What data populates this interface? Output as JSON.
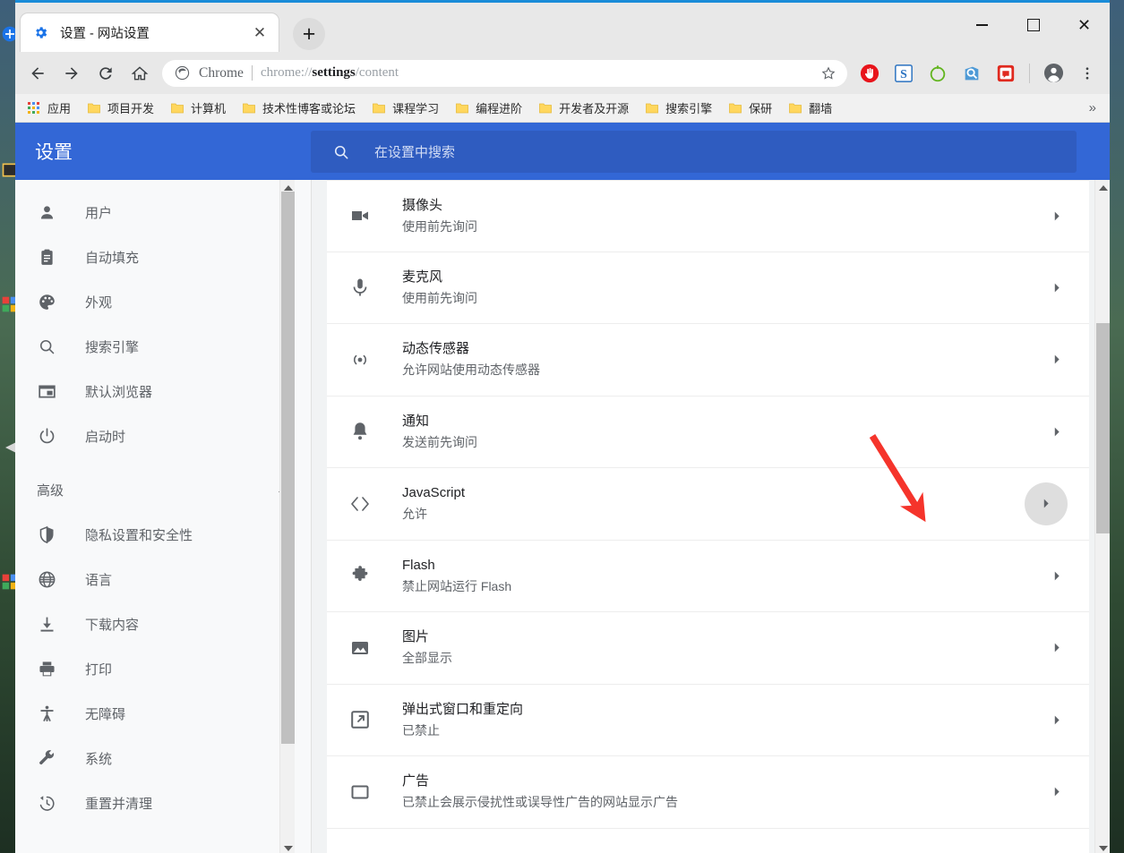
{
  "window": {
    "controls": {
      "minimize": "—",
      "maximize": "□",
      "close": "✕"
    }
  },
  "tabs": [
    {
      "title": "设置 - 网站设置",
      "favicon": "settings-gear-icon",
      "close_label": "✕"
    }
  ],
  "newtab_label": "+",
  "toolbar": {
    "back_label": "←",
    "forward_label": "→",
    "reload_label": "⟳",
    "home_label": "⌂",
    "omnibox": {
      "brand": "Chrome",
      "separator": "|",
      "url_prefix": "chrome://",
      "url_bold": "settings",
      "url_suffix": "/content",
      "full_url": "chrome://settings/content"
    },
    "star_label": "☆",
    "extensions": [
      {
        "name": "adblock-extension-icon",
        "color": "#e8141b"
      },
      {
        "name": "sogou-extension-icon",
        "color": "#2a72c0"
      },
      {
        "name": "green-circle-extension-icon",
        "color": "#63b520"
      },
      {
        "name": "search-magnifier-extension-icon",
        "color": "#3b7dbd"
      },
      {
        "name": "red-square-extension-icon",
        "color": "#e02a1f"
      }
    ],
    "profile_label": "●",
    "menu_label": "⋮"
  },
  "bookmarks": {
    "apps_label": "应用",
    "items": [
      "项目开发",
      "计算机",
      "技术性博客或论坛",
      "课程学习",
      "编程进阶",
      "开发者及开源",
      "搜索引擎",
      "保研",
      "翻墙"
    ],
    "overflow_label": "»"
  },
  "settings": {
    "header": {
      "title": "设置",
      "search_placeholder": "在设置中搜索",
      "accent_color": "#3367d6",
      "search_bg": "#2f5cc0"
    },
    "sidebar": {
      "items": [
        {
          "label": "用户",
          "icon": "person-icon"
        },
        {
          "label": "自动填充",
          "icon": "clipboard-icon"
        },
        {
          "label": "外观",
          "icon": "palette-icon"
        },
        {
          "label": "搜索引擎",
          "icon": "search-icon"
        },
        {
          "label": "默认浏览器",
          "icon": "browser-window-icon"
        },
        {
          "label": "启动时",
          "icon": "power-icon"
        }
      ],
      "section": {
        "label": "高级",
        "icon": "chevron-up-icon",
        "expanded": true
      },
      "advanced_items": [
        {
          "label": "隐私设置和安全性",
          "icon": "shield-icon"
        },
        {
          "label": "语言",
          "icon": "globe-icon"
        },
        {
          "label": "下载内容",
          "icon": "download-icon"
        },
        {
          "label": "打印",
          "icon": "printer-icon"
        },
        {
          "label": "无障碍",
          "icon": "accessibility-icon"
        },
        {
          "label": "系统",
          "icon": "wrench-icon"
        },
        {
          "label": "重置并清理",
          "icon": "history-restore-icon"
        }
      ]
    },
    "content_rows": [
      {
        "title": "摄像头",
        "sub": "使用前先询问",
        "icon": "camera-icon",
        "hovered": false
      },
      {
        "title": "麦克风",
        "sub": "使用前先询问",
        "icon": "microphone-icon",
        "hovered": false
      },
      {
        "title": "动态传感器",
        "sub": "允许网站使用动态传感器",
        "icon": "motion-sensor-icon",
        "hovered": false
      },
      {
        "title": "通知",
        "sub": "发送前先询问",
        "icon": "bell-icon",
        "hovered": false
      },
      {
        "title": "JavaScript",
        "sub": "允许",
        "icon": "code-brackets-icon",
        "hovered": true
      },
      {
        "title": "Flash",
        "sub": "禁止网站运行 Flash",
        "icon": "puzzle-piece-icon",
        "hovered": false
      },
      {
        "title": "图片",
        "sub": "全部显示",
        "icon": "image-icon",
        "hovered": false
      },
      {
        "title": "弹出式窗口和重定向",
        "sub": "已禁止",
        "icon": "popup-window-icon",
        "hovered": false
      },
      {
        "title": "广告",
        "sub": "已禁止会展示侵扰性或误导性广告的网站显示广告",
        "icon": "ad-box-icon",
        "hovered": false
      }
    ],
    "row_chevron_label": "▸"
  },
  "annotation": {
    "type": "red-arrow",
    "color": "#f5342b",
    "points_to": "javascript-row-chevron"
  }
}
